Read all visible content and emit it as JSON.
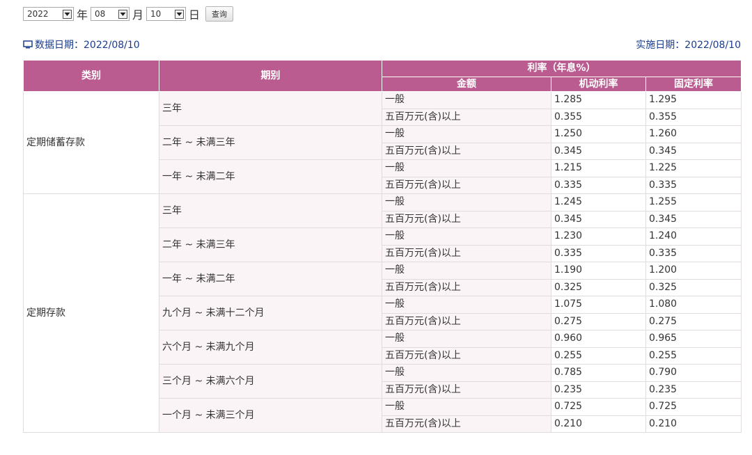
{
  "date_selector": {
    "year": "2022",
    "year_unit": "年",
    "month": "08",
    "month_unit": "月",
    "day": "10",
    "day_unit": "日",
    "query_button": "查询"
  },
  "info": {
    "data_date": "数据日期：2022/08/10",
    "effective_date": "实施日期：2022/08/10"
  },
  "table": {
    "headers": {
      "category": "类别",
      "period": "期别",
      "rate_group": "利率（年息%）",
      "amount": "金额",
      "floating": "机动利率",
      "fixed": "固定利率"
    },
    "rows": [
      {
        "category": "定期储蓄存款",
        "period": "三年",
        "amount": "一般",
        "floating": "1.285",
        "fixed": "1.295"
      },
      {
        "category": "定期储蓄存款",
        "period": "三年",
        "amount": "五百万元(含)以上",
        "floating": "0.355",
        "fixed": "0.355"
      },
      {
        "category": "定期储蓄存款",
        "period": "二年 ~ 未满三年",
        "amount": "一般",
        "floating": "1.250",
        "fixed": "1.260"
      },
      {
        "category": "定期储蓄存款",
        "period": "二年 ~ 未满三年",
        "amount": "五百万元(含)以上",
        "floating": "0.345",
        "fixed": "0.345"
      },
      {
        "category": "定期储蓄存款",
        "period": "一年 ~ 未满二年",
        "amount": "一般",
        "floating": "1.215",
        "fixed": "1.225"
      },
      {
        "category": "定期储蓄存款",
        "period": "一年 ~ 未满二年",
        "amount": "五百万元(含)以上",
        "floating": "0.335",
        "fixed": "0.335"
      },
      {
        "category": "定期存款",
        "period": "三年",
        "amount": "一般",
        "floating": "1.245",
        "fixed": "1.255"
      },
      {
        "category": "定期存款",
        "period": "三年",
        "amount": "五百万元(含)以上",
        "floating": "0.345",
        "fixed": "0.345"
      },
      {
        "category": "定期存款",
        "period": "二年 ~ 未满三年",
        "amount": "一般",
        "floating": "1.230",
        "fixed": "1.240"
      },
      {
        "category": "定期存款",
        "period": "二年 ~ 未满三年",
        "amount": "五百万元(含)以上",
        "floating": "0.335",
        "fixed": "0.335"
      },
      {
        "category": "定期存款",
        "period": "一年 ~ 未满二年",
        "amount": "一般",
        "floating": "1.190",
        "fixed": "1.200"
      },
      {
        "category": "定期存款",
        "period": "一年 ~ 未满二年",
        "amount": "五百万元(含)以上",
        "floating": "0.325",
        "fixed": "0.325"
      },
      {
        "category": "定期存款",
        "period": "九个月 ~ 未满十二个月",
        "amount": "一般",
        "floating": "1.075",
        "fixed": "1.080"
      },
      {
        "category": "定期存款",
        "period": "九个月 ~ 未满十二个月",
        "amount": "五百万元(含)以上",
        "floating": "0.275",
        "fixed": "0.275"
      },
      {
        "category": "定期存款",
        "period": "六个月 ~ 未满九个月",
        "amount": "一般",
        "floating": "0.960",
        "fixed": "0.965"
      },
      {
        "category": "定期存款",
        "period": "六个月 ~ 未满九个月",
        "amount": "五百万元(含)以上",
        "floating": "0.255",
        "fixed": "0.255"
      },
      {
        "category": "定期存款",
        "period": "三个月 ~ 未满六个月",
        "amount": "一般",
        "floating": "0.785",
        "fixed": "0.790"
      },
      {
        "category": "定期存款",
        "period": "三个月 ~ 未满六个月",
        "amount": "五百万元(含)以上",
        "floating": "0.235",
        "fixed": "0.235"
      },
      {
        "category": "定期存款",
        "period": "一个月 ~ 未满三个月",
        "amount": "一般",
        "floating": "0.725",
        "fixed": "0.725"
      },
      {
        "category": "定期存款",
        "period": "一个月 ~ 未满三个月",
        "amount": "五百万元(含)以上",
        "floating": "0.210",
        "fixed": "0.210"
      }
    ]
  },
  "colors": {
    "header_bg": "#bb5c90",
    "label_cell_bg": "#fbf4f7",
    "link_text": "#1a3c8f"
  }
}
